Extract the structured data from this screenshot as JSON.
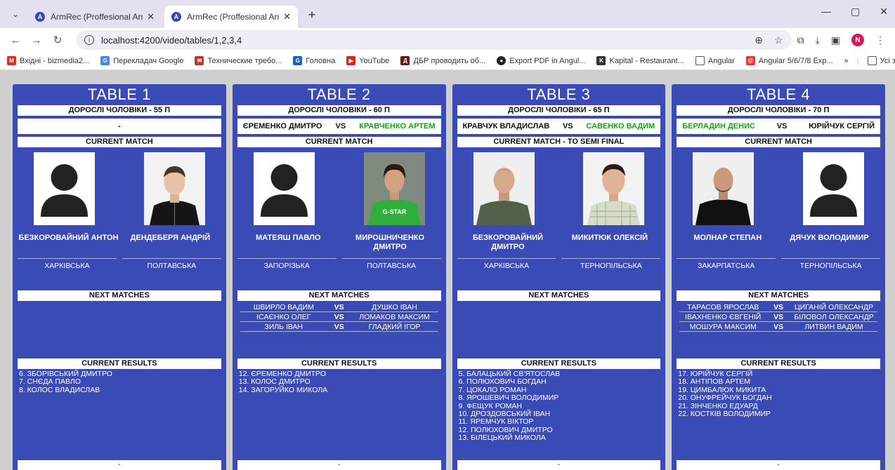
{
  "browser": {
    "tabs": [
      {
        "title": "ArmRec (Proffesional Armwrest",
        "active": false
      },
      {
        "title": "ArmRec (Proffesional Armwrest",
        "active": true
      }
    ],
    "url": "localhost:4200/video/tables/1,2,3,4",
    "bookmarks": [
      {
        "label": "Вхідні - bizmedia2...",
        "icon": "gmail-icon",
        "color": "#d93025"
      },
      {
        "label": "Перекладач Google",
        "icon": "translate-icon",
        "color": "#4285f4"
      },
      {
        "label": "Технические требо...",
        "icon": "mail-icon",
        "color": "#c0392b"
      },
      {
        "label": "Головна",
        "icon": "g-icon",
        "color": "#1565c0"
      },
      {
        "label": "YouTube",
        "icon": "youtube-icon",
        "color": "#e62117"
      },
      {
        "label": "ДБР проводить об...",
        "icon": "dbr-icon",
        "color": "#6b1a1a"
      },
      {
        "label": "Export PDF in Angul...",
        "icon": "github-icon",
        "color": "#222222"
      },
      {
        "label": "Kapital - Restaurant...",
        "icon": "kapital-icon",
        "color": "#333333"
      },
      {
        "label": "Angular",
        "icon": "folder-icon",
        "color": "#555555"
      },
      {
        "label": "Angular 5/6/7/8 Exp...",
        "icon": "angular-icon",
        "color": "#e53935"
      }
    ],
    "all_bookmarks": "Усі закладки",
    "avatar": "N"
  },
  "tables": [
    {
      "title": "TABLE 1",
      "category": "ДОРОСЛІ ЧОЛОВІКИ - 55 П",
      "match": {
        "left": "",
        "vs": "",
        "right": "",
        "placeholder": "-"
      },
      "current_label": "CURRENT MATCH",
      "left": {
        "name": "БЕЗКОРОВАЙНИЙ АНТОН",
        "region": "ХАРКІВСЬКА",
        "photo": "placeholder"
      },
      "right": {
        "name": "ДЕНДЕБЕРЯ АНДРІЙ",
        "region": "ПОЛТАВСЬКА",
        "photo": "person-dark-jacket"
      },
      "next_label": "NEXT MATCHES",
      "next": [],
      "results_label": "CURRENT RESULTS",
      "results": [
        "6. ЗБОРІВСЬКИЙ ДМИТРО",
        "7. СНЄДА ПАВЛО",
        "8. КОЛОС ВЛАДИСЛАВ"
      ],
      "footer": "-"
    },
    {
      "title": "TABLE 2",
      "category": "ДОРОСЛІ ЧОЛОВІКИ - 60 П",
      "match": {
        "left": "ЄРЕМЕНКО ДМИТРО",
        "vs": "VS",
        "right": "КРАВЧЕНКО АРТЕМ",
        "placeholder": ""
      },
      "current_label": "CURRENT MATCH",
      "left": {
        "name": "МАТЕЯШ ПАВЛО",
        "region": "ЗАПОРІЗЬКА",
        "photo": "placeholder"
      },
      "right": {
        "name": "МИРОШНИЧЕНКО ДМИТРО",
        "region": "ПОЛТАВСЬКА",
        "photo": "person-green-shirt"
      },
      "next_label": "NEXT MATCHES",
      "next": [
        {
          "p1": "ШВИРЛО ВАДИМ",
          "vs": "VS",
          "p2": "ДУШКО ІВАН"
        },
        {
          "p1": "ІСАЄНКО ОЛЕГ",
          "vs": "VS",
          "p2": "ЛОМАКОВ МАКСИМ"
        },
        {
          "p1": "ЗИЛЬ ІВАН",
          "vs": "VS",
          "p2": "ГЛАДКИЙ ІГОР"
        }
      ],
      "results_label": "CURRENT RESULTS",
      "results": [
        "12. ЄРЕМЕНКО ДМИТРО",
        "13. КОЛОС ДМИТРО",
        "14. ЗАГОРУЙКО МИКОЛА"
      ],
      "footer": "-"
    },
    {
      "title": "TABLE 3",
      "category": "ДОРОСЛІ ЧОЛОВІКИ - 65 П",
      "match": {
        "left": "КРАВЧУК ВЛАДИСЛАВ",
        "vs": "VS",
        "right": "САВЕНКО ВАДИМ",
        "placeholder": ""
      },
      "current_label": "CURRENT MATCH - TO SEMI FINAL",
      "left": {
        "name": "БЕЗКОРОВАЙНИЙ ДМИТРО",
        "region": "ХАРКІВСЬКА",
        "photo": "person-green-tshirt"
      },
      "right": {
        "name": "МИКИТЮК ОЛЕКСІЙ",
        "region": "ТЕРНОПІЛЬСЬКА",
        "photo": "person-check-shirt"
      },
      "next_label": "NEXT MATCHES",
      "next": [],
      "results_label": "CURRENT RESULTS",
      "results": [
        "5. БАЛАЦЬКИЙ СВ'ЯТОСЛАВ",
        "6. ПОЛЮХОВИЧ БОГДАН",
        "7. ЦОКАЛО РОМАН",
        "8. ЯРОШЕВИЧ ВОЛОДИМИР",
        "9. ФЕЩУК РОМАН",
        "10. ДРОЗДОВСЬКИЙ ІВАН",
        "11. ЯРЕМЧУК ВІКТОР",
        "12. ПОЛЮХОВИЧ ДМИТРО",
        "13. БІЛЕЦЬКИЙ МИКОЛА"
      ],
      "footer": "-"
    },
    {
      "title": "TABLE 4",
      "category": "ДОРОСЛІ ЧОЛОВІКИ - 70 П",
      "match": {
        "left": "БЕРЛАДИН ДЕНИС",
        "vs": "VS",
        "right": "ЮРІЙЧУК СЕРГІЙ",
        "placeholder": ""
      },
      "current_label": "CURRENT MATCH",
      "left": {
        "name": "МОЛНАР СТЕПАН",
        "region": "ЗАКАРПАТСЬКА",
        "photo": "person-black-sweater"
      },
      "right": {
        "name": "ДЯЧУК ВОЛОДИМИР",
        "region": "ТЕРНОПІЛЬСЬКА",
        "photo": "placeholder"
      },
      "next_label": "NEXT MATCHES",
      "next": [
        {
          "p1": "ТАРАСОВ ЯРОСЛАВ",
          "vs": "VS",
          "p2": "ЦИГАНІЙ ОЛЕКСАНДР"
        },
        {
          "p1": "ІВАХНЕНКО ЄВГЕНІЙ",
          "vs": "VS",
          "p2": "БІЛОВОЛ ОЛЕКСАНДР"
        },
        {
          "p1": "МОШУРА МАКСИМ",
          "vs": "VS",
          "p2": "ЛИТВИН ВАДИМ"
        }
      ],
      "results_label": "CURRENT RESULTS",
      "results": [
        "17. ЮРІЙЧУК СЕРГІЙ",
        "18. АНТІПОВ АРТЕМ",
        "19. ЦИМБАЛЮК МИКИТА",
        "20. ОНУФРЕЙЧУК БОГДАН",
        "21. ЗІНЧЕНКО ЕДУАРД",
        "22. КОСТКІВ ВОЛОДИМИР"
      ],
      "footer": "-"
    }
  ]
}
